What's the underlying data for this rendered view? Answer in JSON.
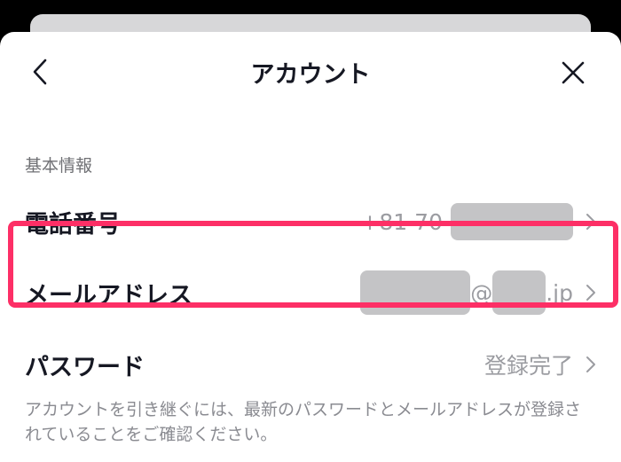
{
  "header": {
    "title": "アカウント",
    "back_icon": "chevron-left-icon",
    "close_icon": "close-icon"
  },
  "section": {
    "label": "基本情報"
  },
  "rows": {
    "phone": {
      "label": "電話番号",
      "value_prefix": "+81 70-"
    },
    "email": {
      "label": "メールアドレス",
      "value_at": "@",
      "value_suffix": ".jp"
    },
    "password": {
      "label": "パスワード",
      "value": "登録完了"
    }
  },
  "note": "アカウントを引き継ぐには、最新のパスワードとメールアドレスが登録されていることをご確認ください。",
  "colors": {
    "highlight": "#fd2f66",
    "text_primary": "#161823",
    "text_secondary": "#9b9ca1",
    "redaction": "#c4c4c6"
  }
}
